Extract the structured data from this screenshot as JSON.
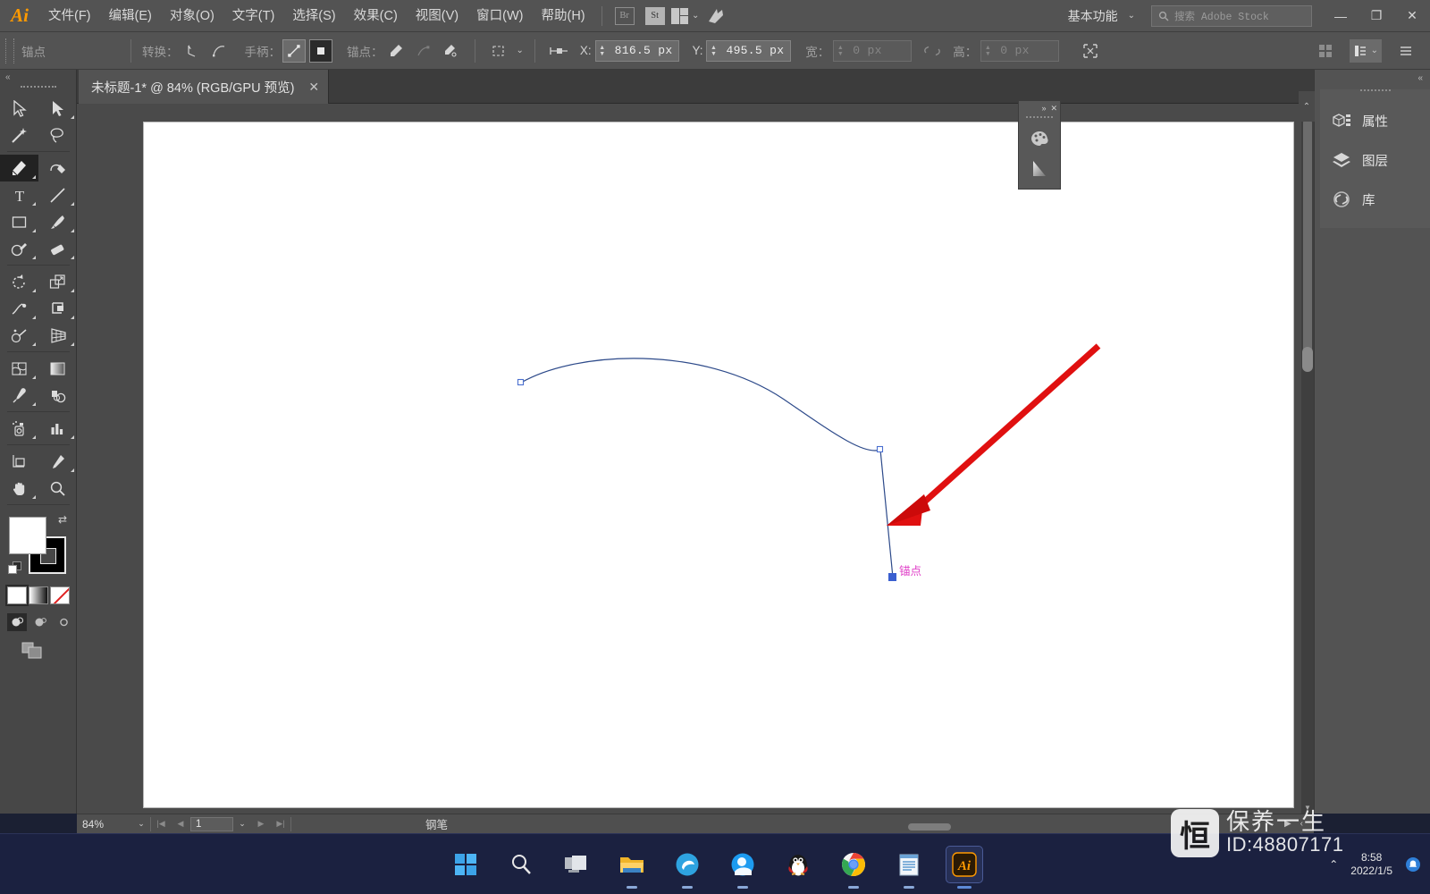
{
  "app": {
    "name": "Adobe Illustrator",
    "logo_text": "Ai"
  },
  "menubar": {
    "items": [
      {
        "label": "文件(F)"
      },
      {
        "label": "编辑(E)"
      },
      {
        "label": "对象(O)"
      },
      {
        "label": "文字(T)"
      },
      {
        "label": "选择(S)"
      },
      {
        "label": "效果(C)"
      },
      {
        "label": "视图(V)"
      },
      {
        "label": "窗口(W)"
      },
      {
        "label": "帮助(H)"
      }
    ],
    "bridge_label": "Br",
    "stock_label": "St",
    "arrange_icon": "arrange-documents-icon",
    "cc_icon": "creative-cloud-icon",
    "workspace_label": "基本功能",
    "workspace_chevron": "⌄",
    "search_placeholder": "搜索 Adobe Stock",
    "search_value": "",
    "window_minimize": "—",
    "window_restore": "❐",
    "window_close": "✕"
  },
  "controlbar": {
    "context_label": "锚点",
    "convert_label": "转换：",
    "convert_corner_icon": "convert-to-corner-icon",
    "convert_smooth_icon": "convert-to-smooth-icon",
    "handles_label": "手柄：",
    "handles_show_icon": "show-handles-icon",
    "handles_hide_icon": "hide-handles-icon",
    "anchors_label": "锚点：",
    "anchor_remove_icon": "remove-anchor-icon",
    "anchor_connect_icon": "connect-anchor-icon",
    "anchor_cut_icon": "cut-path-icon",
    "isolate_icon": "isolate-selected-icon",
    "align_icon": "align-to-pixel-icon",
    "x_label": "X:",
    "x_value": "816.5 px",
    "y_label": "Y:",
    "y_value": "495.5 px",
    "w_label": "宽：",
    "w_value": "0 px",
    "h_label": "高：",
    "h_value": "0 px",
    "link_icon": "unlink-proportions-icon",
    "transform_icon": "transform-panel-icon",
    "grid_icon": "grid-icon",
    "arrange_icon": "arrange-icon",
    "menu_icon": "panel-menu-icon"
  },
  "tabbar": {
    "document_title": "未标题-1* @ 84% (RGB/GPU 预览)",
    "close_icon": "✕",
    "overflow_icon": "«"
  },
  "toolbar": {
    "expand_icon": "«",
    "tools": [
      {
        "name": "selection-tool",
        "label": "选择工具",
        "selected": false
      },
      {
        "name": "direct-selection-tool",
        "label": "直接选择工具",
        "selected": false
      },
      {
        "name": "magic-wand-tool",
        "label": "魔棒工具",
        "selected": false
      },
      {
        "name": "lasso-tool",
        "label": "套索工具",
        "selected": false
      },
      {
        "name": "pen-tool",
        "label": "钢笔工具",
        "selected": true
      },
      {
        "name": "curvature-tool",
        "label": "曲率工具",
        "selected": false
      },
      {
        "name": "type-tool",
        "label": "文字工具",
        "selected": false
      },
      {
        "name": "line-segment-tool",
        "label": "直线段工具",
        "selected": false
      },
      {
        "name": "rectangle-tool",
        "label": "矩形工具",
        "selected": false
      },
      {
        "name": "paintbrush-tool",
        "label": "画笔工具",
        "selected": false
      },
      {
        "name": "shaper-tool",
        "label": "Shaper 工具",
        "selected": false
      },
      {
        "name": "eraser-tool",
        "label": "橡皮擦工具",
        "selected": false
      },
      {
        "name": "rotate-tool",
        "label": "旋转工具",
        "selected": false
      },
      {
        "name": "scale-tool",
        "label": "比例缩放工具",
        "selected": false
      },
      {
        "name": "width-tool",
        "label": "宽度工具",
        "selected": false
      },
      {
        "name": "free-transform-tool",
        "label": "自由变换工具",
        "selected": false
      },
      {
        "name": "shape-builder-tool",
        "label": "形状生成器工具",
        "selected": false
      },
      {
        "name": "perspective-grid-tool",
        "label": "透视网格工具",
        "selected": false
      },
      {
        "name": "mesh-tool",
        "label": "网格工具",
        "selected": false
      },
      {
        "name": "gradient-tool",
        "label": "渐变工具",
        "selected": false
      },
      {
        "name": "eyedropper-tool",
        "label": "吸管工具",
        "selected": false
      },
      {
        "name": "blend-tool",
        "label": "混合工具",
        "selected": false
      },
      {
        "name": "symbol-sprayer-tool",
        "label": "符号喷枪工具",
        "selected": false
      },
      {
        "name": "column-graph-tool",
        "label": "柱形图工具",
        "selected": false
      },
      {
        "name": "artboard-tool",
        "label": "画板工具",
        "selected": false
      },
      {
        "name": "slice-tool",
        "label": "切片工具",
        "selected": false
      },
      {
        "name": "hand-tool",
        "label": "抓手工具",
        "selected": false
      },
      {
        "name": "zoom-tool",
        "label": "缩放工具",
        "selected": false
      }
    ],
    "fill_color": "#ffffff",
    "stroke_color": "#000000",
    "swap_icon": "swap-fill-stroke-icon",
    "default_icon": "default-fill-stroke-icon",
    "paint_modes": [
      {
        "name": "color-mode",
        "selected": true
      },
      {
        "name": "gradient-mode",
        "selected": false
      },
      {
        "name": "none-mode",
        "selected": false
      }
    ],
    "screen_modes": [
      {
        "name": "normal-screen-mode",
        "selected": true
      },
      {
        "name": "full-screen-menubar-mode",
        "selected": false
      },
      {
        "name": "full-screen-mode",
        "selected": false
      }
    ],
    "edit_toolbar_icon": "edit-toolbar-icon"
  },
  "canvas": {
    "artboard_background": "#ffffff",
    "path_color": "#2d4a8a",
    "anchor_annotation": "锚点",
    "anchor_annotation_color": "#e040c8",
    "selected_anchor_color": "#3a5fd0",
    "arrow_color": "#e01010",
    "arrow_name": "red-annotation-arrow"
  },
  "minipanel": {
    "collapse_icon": "»",
    "close_icon": "✕",
    "buttons": [
      {
        "name": "color-panel-icon",
        "label": "颜色"
      },
      {
        "name": "gradient-panel-icon",
        "label": "渐变"
      }
    ]
  },
  "rightdock": {
    "collapse_icon": "«",
    "expand_icon": "⌃",
    "panels": [
      {
        "icon": "properties-icon",
        "label": "属性"
      },
      {
        "icon": "layers-icon",
        "label": "图层"
      },
      {
        "icon": "libraries-icon",
        "label": "库"
      }
    ]
  },
  "statusbar": {
    "zoom_value": "84%",
    "zoom_chevron": "⌄",
    "first_page_icon": "|◀",
    "prev_page_icon": "◀",
    "page_value": "1",
    "page_chevron": "⌄",
    "next_page_icon": "▶",
    "last_page_icon": "▶|",
    "current_tool": "钢笔",
    "tool_arrow_icon": "▶",
    "overflow_icon": "‹"
  },
  "taskbar": {
    "items": [
      {
        "name": "start-button",
        "label": "开始",
        "active": false,
        "running": false
      },
      {
        "name": "search-button",
        "label": "搜索",
        "active": false,
        "running": false
      },
      {
        "name": "task-view-button",
        "label": "任务视图",
        "active": false,
        "running": false
      },
      {
        "name": "file-explorer-button",
        "label": "文件资源管理器",
        "active": false,
        "running": true
      },
      {
        "name": "edge-button",
        "label": "Microsoft Edge",
        "active": false,
        "running": true
      },
      {
        "name": "browser-button",
        "label": "浏览器",
        "active": false,
        "running": true
      },
      {
        "name": "qq-button",
        "label": "QQ",
        "active": false,
        "running": false
      },
      {
        "name": "chrome-button",
        "label": "Google Chrome",
        "active": false,
        "running": true
      },
      {
        "name": "notepad-button",
        "label": "记事本",
        "active": false,
        "running": true
      },
      {
        "name": "illustrator-button",
        "label": "Adobe Illustrator",
        "active": true,
        "running": true
      }
    ],
    "tray_expand_icon": "⌃",
    "tray_time": "8:58",
    "tray_date": "2022/1/5",
    "notification_icon": "notification-icon"
  },
  "watermark": {
    "logo_glyph": "恒",
    "name": "保养一生",
    "id_text": "ID:48807171"
  }
}
